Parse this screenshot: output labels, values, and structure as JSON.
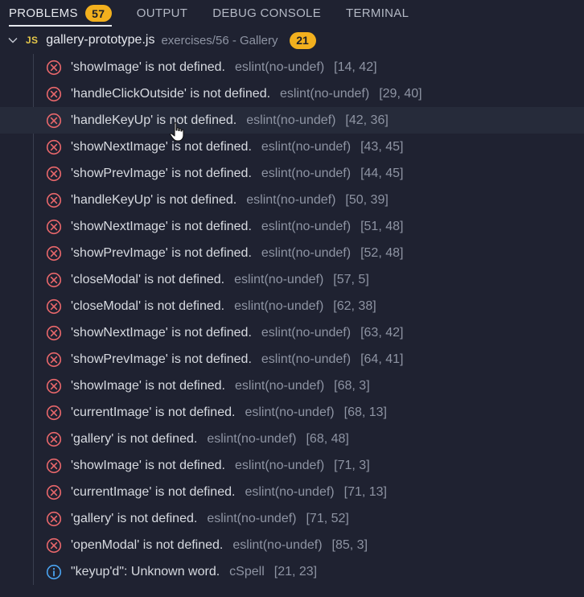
{
  "tabs": [
    {
      "label": "PROBLEMS",
      "badge": "57",
      "active": true
    },
    {
      "label": "OUTPUT"
    },
    {
      "label": "DEBUG CONSOLE"
    },
    {
      "label": "TERMINAL"
    }
  ],
  "file": {
    "icon_text": "JS",
    "name": "gallery-prototype.js",
    "path": "exercises/56 - Gallery",
    "count": "21"
  },
  "problems": [
    {
      "type": "error",
      "message": "'showImage' is not defined.",
      "source": "eslint(no-undef)",
      "position": "[14, 42]"
    },
    {
      "type": "error",
      "message": "'handleClickOutside' is not defined.",
      "source": "eslint(no-undef)",
      "position": "[29, 40]"
    },
    {
      "type": "error",
      "message": "'handleKeyUp' is not defined.",
      "source": "eslint(no-undef)",
      "position": "[42, 36]"
    },
    {
      "type": "error",
      "message": "'showNextImage' is not defined.",
      "source": "eslint(no-undef)",
      "position": "[43, 45]"
    },
    {
      "type": "error",
      "message": "'showPrevImage' is not defined.",
      "source": "eslint(no-undef)",
      "position": "[44, 45]"
    },
    {
      "type": "error",
      "message": "'handleKeyUp' is not defined.",
      "source": "eslint(no-undef)",
      "position": "[50, 39]"
    },
    {
      "type": "error",
      "message": "'showNextImage' is not defined.",
      "source": "eslint(no-undef)",
      "position": "[51, 48]"
    },
    {
      "type": "error",
      "message": "'showPrevImage' is not defined.",
      "source": "eslint(no-undef)",
      "position": "[52, 48]"
    },
    {
      "type": "error",
      "message": "'closeModal' is not defined.",
      "source": "eslint(no-undef)",
      "position": "[57, 5]"
    },
    {
      "type": "error",
      "message": "'closeModal' is not defined.",
      "source": "eslint(no-undef)",
      "position": "[62, 38]"
    },
    {
      "type": "error",
      "message": "'showNextImage' is not defined.",
      "source": "eslint(no-undef)",
      "position": "[63, 42]"
    },
    {
      "type": "error",
      "message": "'showPrevImage' is not defined.",
      "source": "eslint(no-undef)",
      "position": "[64, 41]"
    },
    {
      "type": "error",
      "message": "'showImage' is not defined.",
      "source": "eslint(no-undef)",
      "position": "[68, 3]"
    },
    {
      "type": "error",
      "message": "'currentImage' is not defined.",
      "source": "eslint(no-undef)",
      "position": "[68, 13]"
    },
    {
      "type": "error",
      "message": "'gallery' is not defined.",
      "source": "eslint(no-undef)",
      "position": "[68, 48]"
    },
    {
      "type": "error",
      "message": "'showImage' is not defined.",
      "source": "eslint(no-undef)",
      "position": "[71, 3]"
    },
    {
      "type": "error",
      "message": "'currentImage' is not defined.",
      "source": "eslint(no-undef)",
      "position": "[71, 13]"
    },
    {
      "type": "error",
      "message": "'gallery' is not defined.",
      "source": "eslint(no-undef)",
      "position": "[71, 52]"
    },
    {
      "type": "error",
      "message": "'openModal' is not defined.",
      "source": "eslint(no-undef)",
      "position": "[85, 3]"
    },
    {
      "type": "info",
      "message": "\"keyup'd\": Unknown word.",
      "source": "cSpell",
      "position": "[21, 23]"
    }
  ],
  "hover_index": 2,
  "colors": {
    "badge": "#f2b01e",
    "error": "#e8676b",
    "info": "#4aa3f0",
    "js": "#e6c84a"
  }
}
